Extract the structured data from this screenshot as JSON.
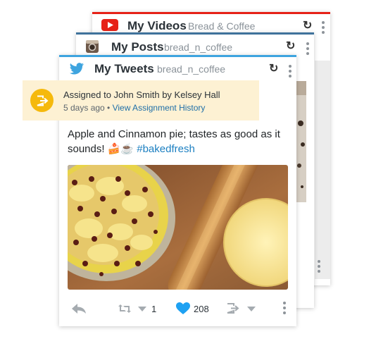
{
  "cards": {
    "youtube": {
      "title": "My Videos",
      "account": "Bread & Coffee",
      "icon": "youtube-icon",
      "accent": "#e62117"
    },
    "instagram": {
      "title": "My Posts",
      "account": "bread_n_coffee",
      "icon": "instagram-icon",
      "accent": "#3f729b"
    },
    "twitter": {
      "title": "My Tweets",
      "account": "bread_n_coffee",
      "icon": "twitter-icon",
      "accent": "#3ea4df"
    }
  },
  "assignment": {
    "text": "Assigned to John Smith by Kelsey Hall",
    "age": "5 days ago •",
    "history_link": "View Assignment History",
    "icon": "assign-icon",
    "accent": "#f5b90c"
  },
  "tweet": {
    "text": "Apple and Cinnamon pie; tastes as good as it sounds! 🍰☕",
    "hashtag": "#bakedfresh",
    "retweets": "1",
    "likes": "208"
  },
  "colors": {
    "link": "#1b7fc1",
    "like": "#1ea1f2"
  }
}
